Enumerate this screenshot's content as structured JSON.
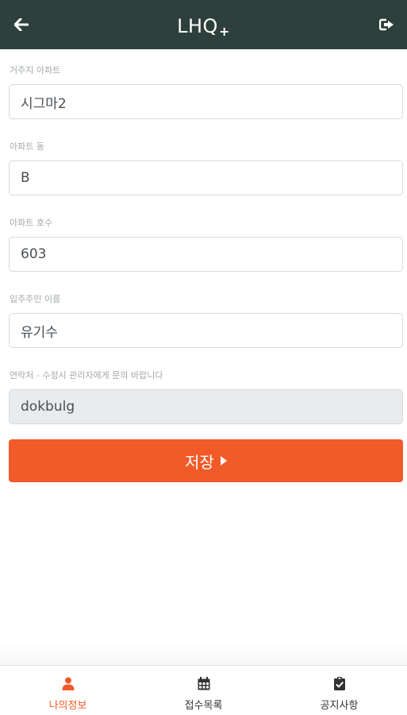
{
  "header": {
    "title": "LHQ",
    "title_suffix": "+",
    "back_icon": "arrow-left-icon",
    "logout_icon": "sign-out-icon",
    "background_color": "#2e403c"
  },
  "form": {
    "fields": [
      {
        "label": "거주지 아파트",
        "value": "시그마2",
        "readonly": false
      },
      {
        "label": "아파트 동",
        "value": "B",
        "readonly": false
      },
      {
        "label": "아파트 호수",
        "value": "603",
        "readonly": false
      },
      {
        "label": "입주주민 이름",
        "value": "유기수",
        "readonly": false
      },
      {
        "label": "연락처 - 수정시 관리자에게 문의 바랍니다",
        "value": "dokbulg",
        "readonly": true
      }
    ],
    "save_label": "저장",
    "save_icon": "caret-right-icon",
    "accent_color": "#f15a29"
  },
  "nav": {
    "items": [
      {
        "label": "나의정보",
        "icon": "user-icon",
        "active": true
      },
      {
        "label": "접수목록",
        "icon": "calendar-icon",
        "active": false
      },
      {
        "label": "공지사항",
        "icon": "clipboard-check-icon",
        "active": false
      }
    ]
  }
}
